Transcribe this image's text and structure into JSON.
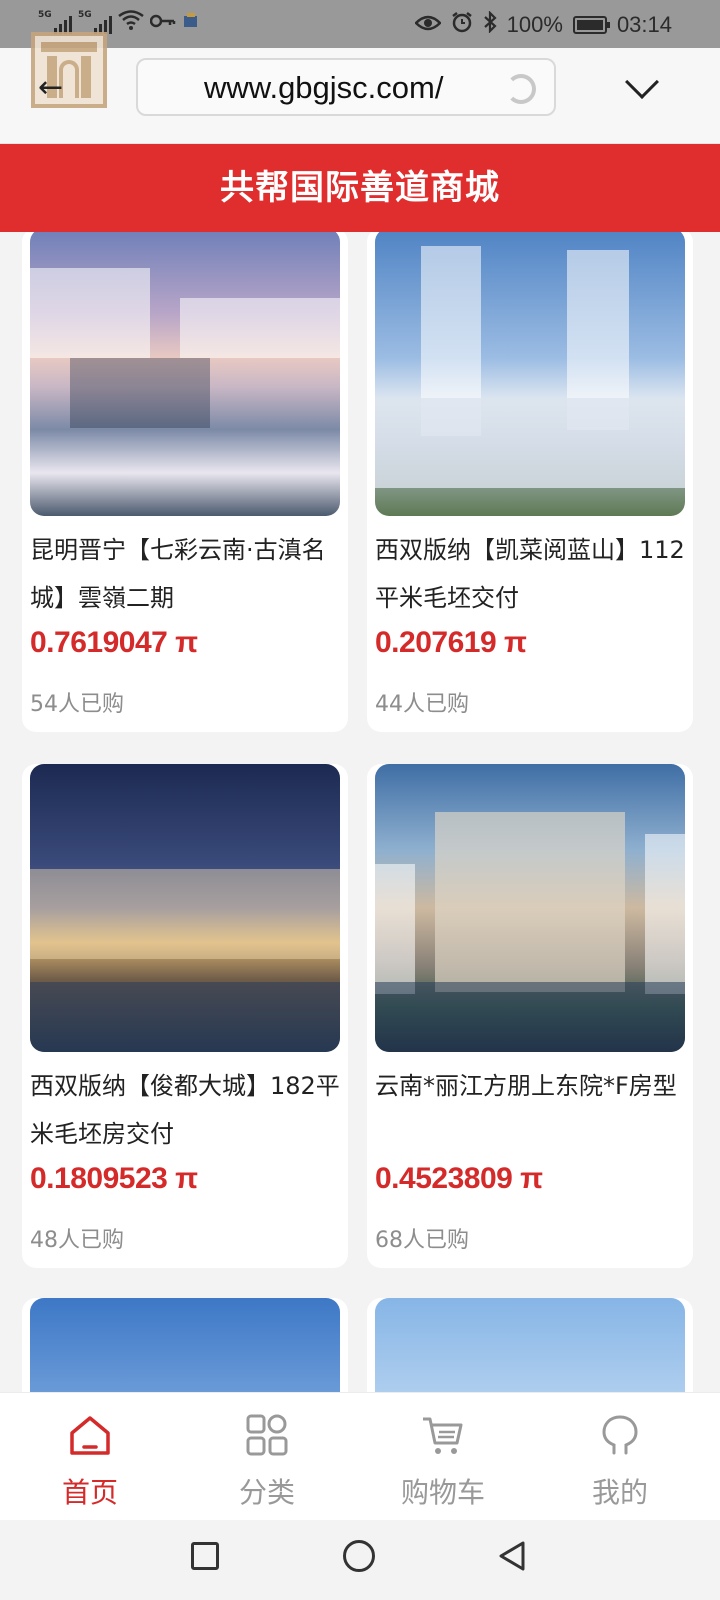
{
  "status_bar": {
    "net1": "5G",
    "net2": "5G",
    "battery": "100%",
    "time": "03:14"
  },
  "browser": {
    "url": "www.gbgjsc.com/",
    "back_icon": "back-arrow-icon",
    "refresh_icon": "refresh-icon",
    "menu_icon": "chevron-down-icon"
  },
  "header": {
    "title": "共帮国际善道商城",
    "color": "#e02e2e"
  },
  "products": [
    {
      "title": "昆明晋宁【七彩云南·古滇名城】雲嶺二期",
      "price": "0.7619047 π",
      "sold": "54人已购"
    },
    {
      "title": "西双版纳【凯菜阅蓝山】112平米毛坯交付",
      "price": "0.207619 π",
      "sold": "44人已购"
    },
    {
      "title": "西双版纳【俊都大城】182平米毛坯房交付",
      "price": "0.1809523 π",
      "sold": "48人已购"
    },
    {
      "title": "云南*丽江方朋上东院*F房型",
      "price": "0.4523809 π",
      "sold": "68人已购"
    }
  ],
  "nav": [
    {
      "label": "首页",
      "icon": "home-icon"
    },
    {
      "label": "分类",
      "icon": "category-icon"
    },
    {
      "label": "购物车",
      "icon": "cart-icon"
    },
    {
      "label": "我的",
      "icon": "profile-icon"
    }
  ],
  "colors": {
    "accent": "#d42a2a",
    "muted": "#999999"
  }
}
